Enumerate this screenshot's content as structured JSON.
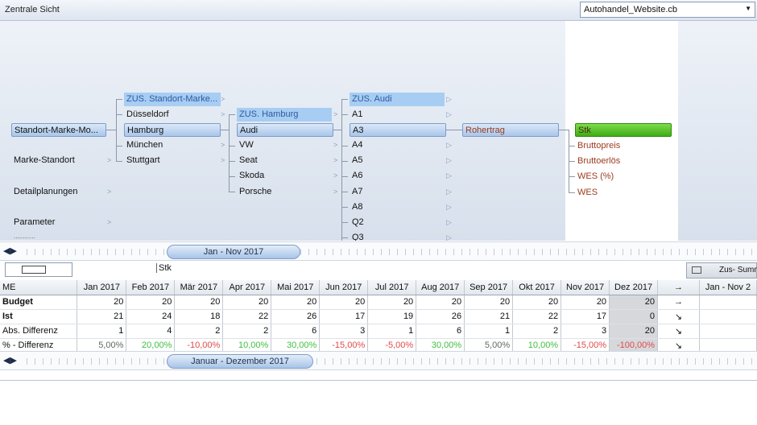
{
  "titlebar": {
    "title": "Zentrale Sicht",
    "cube": "Autohandel_Website.cb"
  },
  "tree": {
    "col1": [
      "Standort-Marke-Mo...",
      "Marke-Standort",
      "Detailplanungen",
      "Parameter",
      "............"
    ],
    "col2": [
      "ZUS. Standort-Marke...",
      "Düsseldorf",
      "Hamburg",
      "München",
      "Stuttgart"
    ],
    "col3": [
      "ZUS. Hamburg",
      "Audi",
      "VW",
      "Seat",
      "Skoda",
      "Porsche"
    ],
    "col4": [
      "ZUS. Audi",
      "A1",
      "A3",
      "A4",
      "A5",
      "A6",
      "A7",
      "A8",
      "Q2",
      "Q3"
    ],
    "col5": [
      "Rohertrag"
    ],
    "col6": [
      "Stk",
      "Bruttopreis",
      "Bruttoerlös",
      "WES (%)",
      "WES"
    ]
  },
  "slider_top": {
    "range": "Jan - Nov 2017"
  },
  "toolbar": {
    "unit": "Stk",
    "sum": "Zus- Summ"
  },
  "grid": {
    "headers": [
      "ME",
      "Jan 2017",
      "Feb 2017",
      "Mär 2017",
      "Apr 2017",
      "Mai 2017",
      "Jun 2017",
      "Jul 2017",
      "Aug 2017",
      "Sep 2017",
      "Okt 2017",
      "Nov 2017",
      "Dez 2017",
      "→",
      "Jan - Nov 2"
    ],
    "rows": [
      {
        "label": "Budget",
        "values": [
          "20",
          "20",
          "20",
          "20",
          "20",
          "20",
          "20",
          "20",
          "20",
          "20",
          "20",
          "20"
        ],
        "arrow": "→"
      },
      {
        "label": "Ist",
        "values": [
          "21",
          "24",
          "18",
          "22",
          "26",
          "17",
          "19",
          "26",
          "21",
          "22",
          "17",
          "0"
        ],
        "arrow": "↘"
      },
      {
        "label": "Abs. Differenz",
        "values": [
          "1",
          "4",
          "2",
          "2",
          "6",
          "3",
          "1",
          "6",
          "1",
          "2",
          "3",
          "20"
        ],
        "arrow": "↘"
      },
      {
        "label": "% - Differenz",
        "values": [
          "5,00%",
          "20,00%",
          "-10,00%",
          "10,00%",
          "30,00%",
          "-15,00%",
          "-5,00%",
          "30,00%",
          "5,00%",
          "10,00%",
          "-15,00%",
          "-100,00%"
        ],
        "arrow": "↘"
      }
    ]
  },
  "slider_bottom": {
    "range": "Januar - Dezember 2017"
  }
}
